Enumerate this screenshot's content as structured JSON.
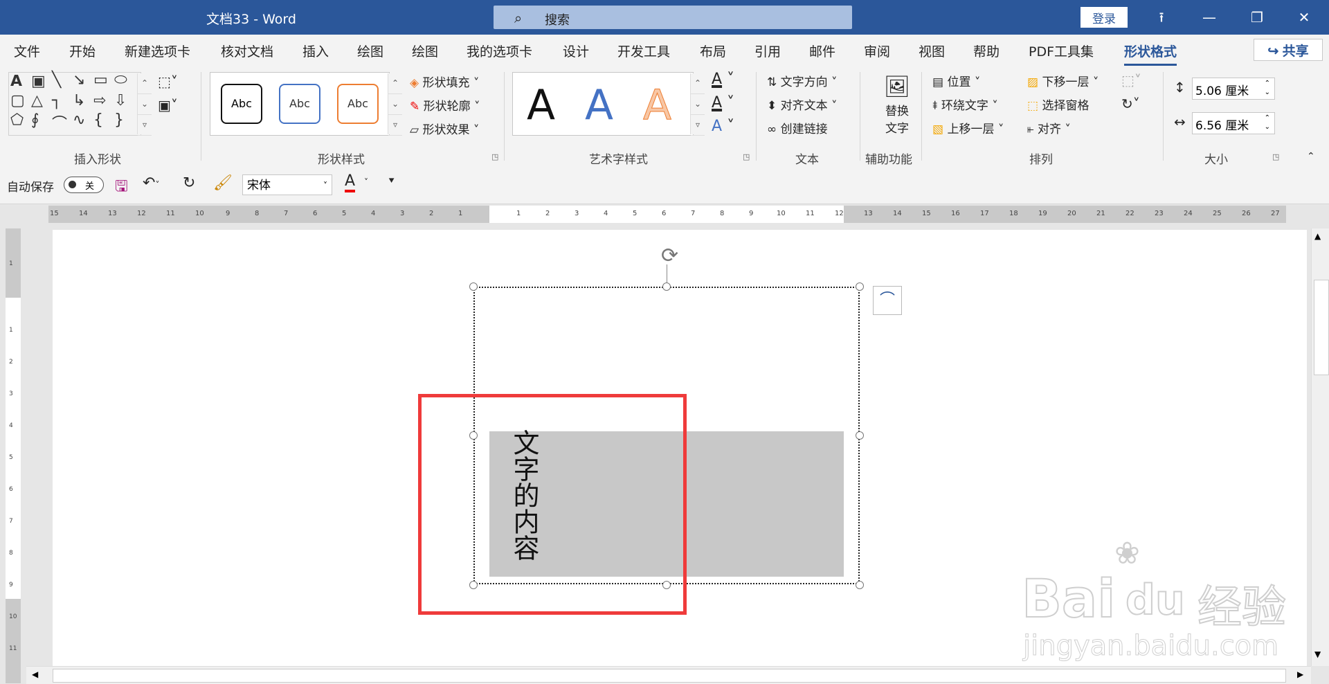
{
  "titlebar": {
    "doc_title": "文档33  -  Word",
    "search_placeholder": "搜索",
    "login": "登录"
  },
  "tabs": [
    "文件",
    "开始",
    "新建选项卡",
    "核对文档",
    "插入",
    "绘图",
    "绘图",
    "我的选项卡",
    "设计",
    "开发工具",
    "布局",
    "引用",
    "邮件",
    "审阅",
    "视图",
    "帮助",
    "PDF工具集",
    "形状格式"
  ],
  "share": "共享",
  "ribbon": {
    "groups": {
      "insert_shapes": "插入形状",
      "shape_styles": "形状样式",
      "wordart": "艺术字样式",
      "text": "文本",
      "accessibility": "辅助功能",
      "arrange": "排列",
      "size": "大小"
    },
    "abc": "Abc",
    "shape_fill": "形状填充",
    "shape_outline": "形状轮廓",
    "shape_effect": "形状效果",
    "wordart_letter": "A",
    "text_direction": "文字方向",
    "align_text": "对齐文本",
    "create_link": "创建链接",
    "alt_text_1": "替换",
    "alt_text_2": "文字",
    "position": "位置",
    "wrap_text": "环绕文字",
    "bring_forward": "上移一层",
    "send_backward": "下移一层",
    "selection_pane": "选择窗格",
    "align": "对齐",
    "height_value": "5.06 厘米",
    "width_value": "6.56 厘米"
  },
  "qat": {
    "autosave": "自动保存",
    "autosave_state": "关",
    "font": "宋体",
    "font_color_letter": "A"
  },
  "document": {
    "vertical_text": "文字的内容"
  },
  "watermark": {
    "brand": "Bai",
    "brand2": "du",
    "jingyan": "经验",
    "url": "jingyan.baidu.com"
  },
  "colors": {
    "accent": "#2b579a",
    "highlight": "#ef3b3b",
    "shape_fill": "#c8c8c8"
  }
}
